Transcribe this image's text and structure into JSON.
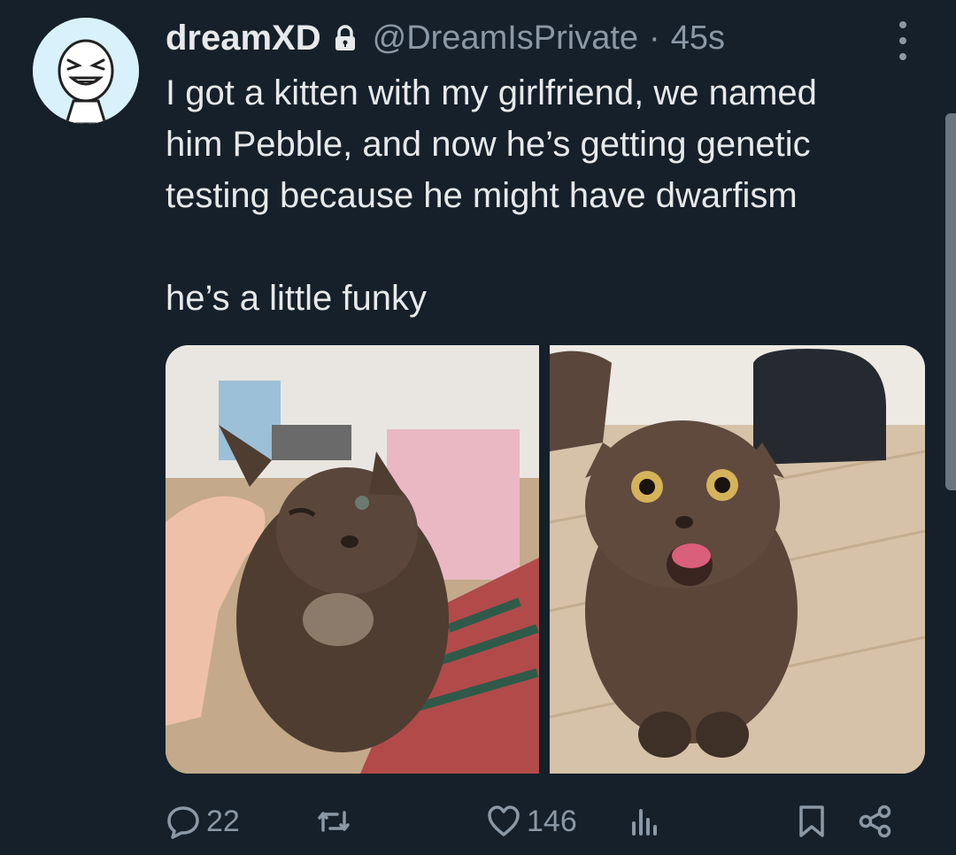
{
  "tweet": {
    "display_name": "dreamXD",
    "handle": "@DreamIsPrivate",
    "separator": "·",
    "time": "45s",
    "text": "I got a kitten with my girlfriend, we named\nhim Pebble, and now he’s getting genetic\ntesting because he might have dwarfism\n\nhe’s a little funky",
    "media": [
      {
        "description": "kitten being petted, one eye closed"
      },
      {
        "description": "kitten looking up with tongue out"
      }
    ]
  },
  "actions": {
    "replies": "22",
    "retweets": "",
    "likes": "146"
  },
  "colors": {
    "background": "#15202b",
    "text": "#e7e9ea",
    "muted": "#8b98a5"
  }
}
